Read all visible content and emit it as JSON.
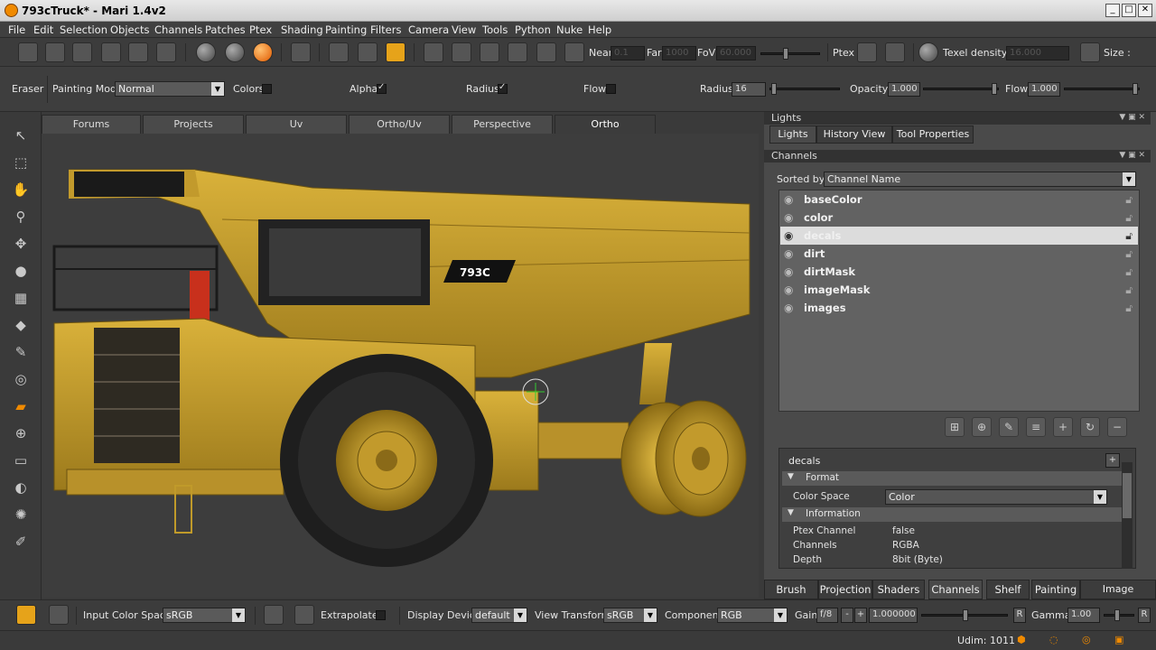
{
  "window": {
    "title": "793cTruck* - Mari 1.4v2",
    "min": "_",
    "max": "□",
    "close": "✕"
  },
  "menu": [
    "File",
    "Edit",
    "Selection",
    "Objects",
    "Channels",
    "Patches",
    "Ptex",
    "Shading",
    "Painting",
    "Filters",
    "Camera",
    "View",
    "Tools",
    "Python",
    "Nuke",
    "Help"
  ],
  "toolbar1": {
    "near_label": "Near",
    "near_value": "0.1",
    "far_label": "Far",
    "far_value": "1000",
    "fov_label": "FoV",
    "fov_value": "60.000",
    "ptex_label": "Ptex",
    "texel_label": "Texel density :",
    "texel_value": "16.000",
    "size_label": "Size :"
  },
  "toolbar2": {
    "tool_name": "Eraser",
    "painting_mode_label": "Painting Mode",
    "painting_mode_value": "Normal",
    "colors_label": "Colors",
    "alpha_label": "Alpha",
    "radius_check_label": "Radius",
    "flow_check_label": "Flow",
    "radius_label": "Radius",
    "radius_value": "16",
    "opacity_label": "Opacity",
    "opacity_value": "1.000",
    "flow_label": "Flow",
    "flow_value": "1.000"
  },
  "viewport_tabs": [
    "Forums",
    "Projects",
    "Uv",
    "Ortho/Uv",
    "Perspective",
    "Ortho"
  ],
  "viewport": {
    "truck_decal": "793C"
  },
  "lights_panel": {
    "header": "Lights",
    "tabs": [
      "Lights",
      "History View",
      "Tool Properties"
    ]
  },
  "channels_panel": {
    "header": "Channels",
    "sorted_by_label": "Sorted by",
    "sorted_by_value": "Channel Name",
    "channels": [
      "baseColor",
      "color",
      "decals",
      "dirt",
      "dirtMask",
      "imageMask",
      "images"
    ],
    "selected_index": 2
  },
  "properties": {
    "title": "decals",
    "section_format": "Format",
    "color_space_label": "Color Space",
    "color_space_value": "Color",
    "section_info": "Information",
    "rows": [
      {
        "k": "Ptex Channel",
        "v": "false"
      },
      {
        "k": "Channels",
        "v": "RGBA"
      },
      {
        "k": "Depth",
        "v": "8bit  (Byte)"
      }
    ]
  },
  "bottom_tabs": [
    "Brush Editor",
    "Projection",
    "Shaders",
    "Channels",
    "Shelf",
    "Painting",
    "Image Manager"
  ],
  "statusbar": {
    "input_cs_label": "Input Color Space",
    "input_cs_value": "sRGB",
    "extrapolate_label": "Extrapolate",
    "display_device_label": "Display Device",
    "display_device_value": "default",
    "view_transform_label": "View Transform",
    "view_transform_value": "sRGB",
    "component_label": "Component",
    "component_value": "RGB",
    "gain_label": "Gain",
    "gain_fstop": "f/8",
    "gain_minus": "-",
    "gain_plus": "+",
    "gain_value": "1.000000",
    "reset_r": "R",
    "gamma_label": "Gamma",
    "gamma_value": "1.00",
    "reset_r2": "R"
  },
  "footer": {
    "udim": "Udim: 1011"
  },
  "colors": {
    "accent": "#e6a31a",
    "truck_yellow": "#c9a227",
    "selected_row": "#dcdcdc"
  }
}
